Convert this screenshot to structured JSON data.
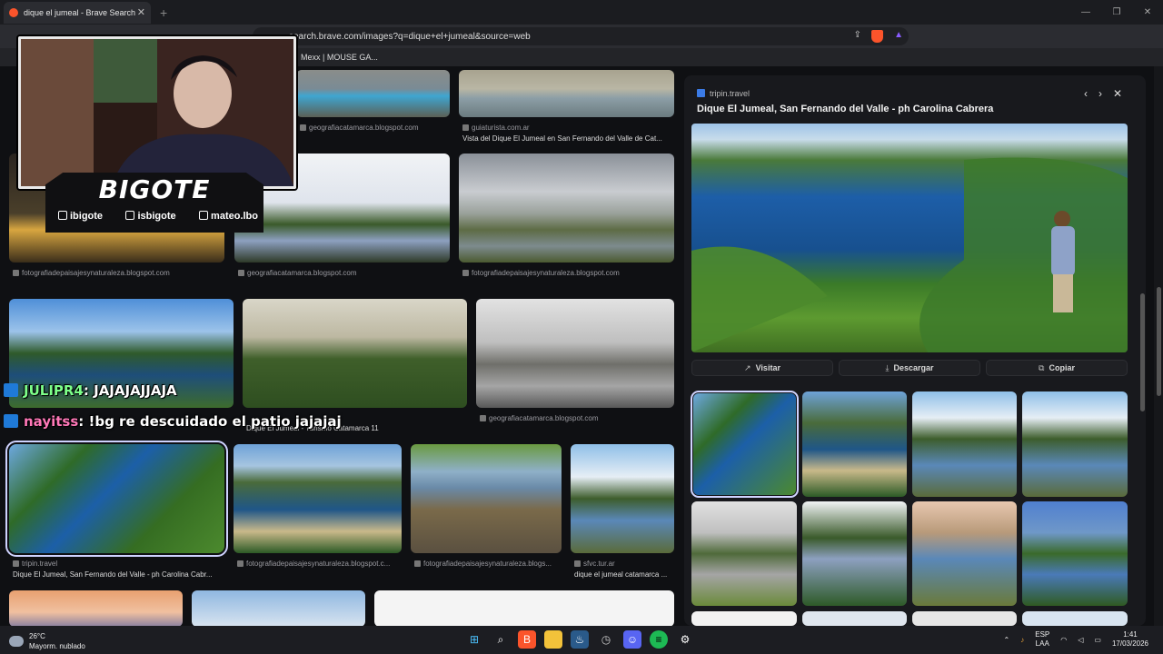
{
  "browser": {
    "tab_title": "dique el jumeal - Brave Search",
    "url": "search.brave.com/images?q=dique+el+jumeal&source=web",
    "bookmark": "Mexx | MOUSE GA..."
  },
  "grid": [
    {
      "source": "geografiacatamarca.blogspot.com"
    },
    {
      "source": "guiaturista.com.ar",
      "title": "Vista del Dique El Jumeal en San Fernando del Valle de Cat..."
    },
    {
      "source": "fotografiadepaisajesynaturaleza.blogspot.com"
    },
    {
      "source": "geografiacatamarca.blogspot.com"
    },
    {
      "source": "fotografiadepaisajesynaturaleza.blogspot.com"
    },
    {
      "source": "geografiacatamarca.blogspot.com"
    },
    {
      "title": "Dique El Jumeal - Turismo Catamarca 11"
    },
    {
      "source": "tripin.travel",
      "title": "Dique El Jumeal, San Fernando del Valle - ph Carolina Cabr..."
    },
    {
      "source": "fotografiadepaisajesynaturaleza.blogspot.c..."
    },
    {
      "source": "fotografiadepaisajesynaturaleza.blogs..."
    },
    {
      "source": "sfvc.tur.ar",
      "title": "dique el jumeal catamarca ..."
    }
  ],
  "panel": {
    "source": "tripin.travel",
    "title": "Dique El Jumeal, San Fernando del Valle - ph Carolina Cabrera",
    "visit": "Visitar",
    "download": "Descargar",
    "copy": "Copiar"
  },
  "stream": {
    "brand": "BIGOTE",
    "twitch": "ibigote",
    "tiktok": "isbigote",
    "instagram": "mateo.lbo",
    "chat": [
      {
        "user": "JULIPR4",
        "msg": ": JAJAJAJJAJA"
      },
      {
        "user": "nayitss",
        "msg": ": !bg re descuidado el patio jajajaj"
      }
    ]
  },
  "taskbar": {
    "temp": "26°C",
    "weather": "Mayorm. nublado",
    "lang": "ESP",
    "layout": "LAA",
    "time": "1:41",
    "date": "17/03/2026"
  }
}
